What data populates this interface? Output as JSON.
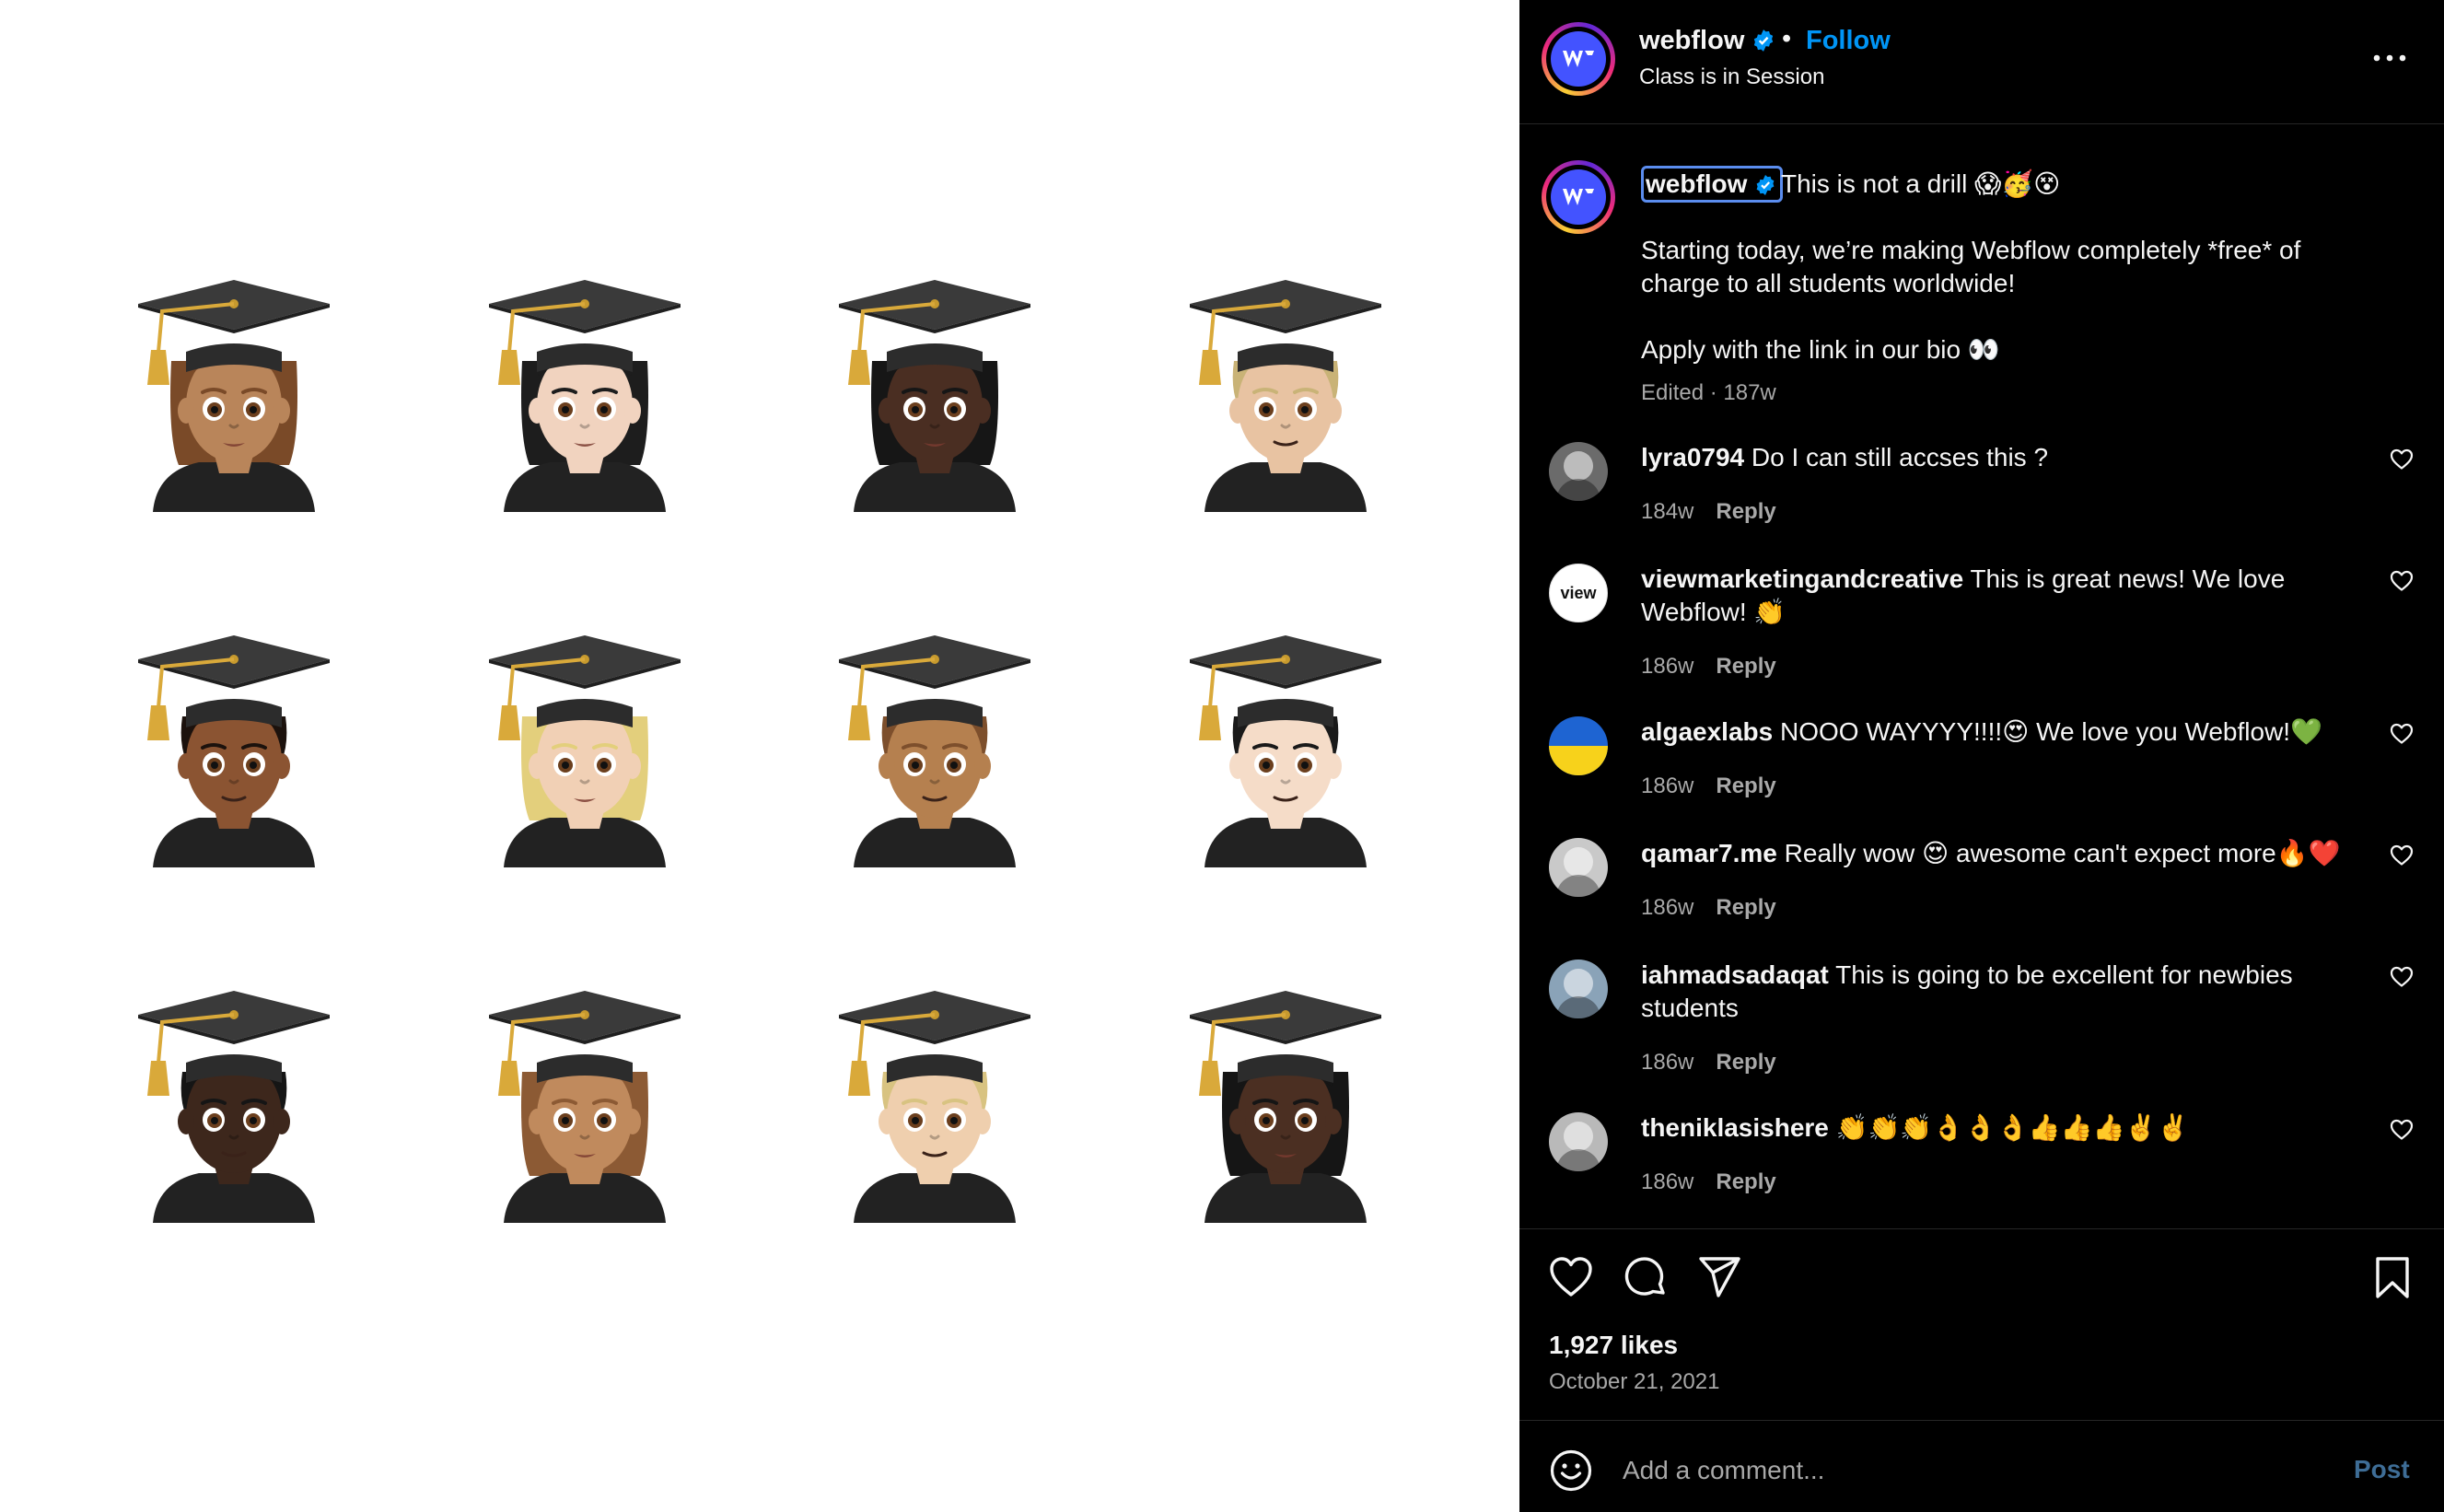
{
  "media": {
    "grads": [
      {
        "skin": "#b9855a",
        "hair": "#7a4a28",
        "style": "long",
        "feminine": true
      },
      {
        "skin": "#f1d3bf",
        "hair": "#1d1d1d",
        "style": "long",
        "feminine": true
      },
      {
        "skin": "#4a2e22",
        "hair": "#161616",
        "style": "long",
        "feminine": true
      },
      {
        "skin": "#e8c3a2",
        "hair": "#c9b377",
        "style": "short",
        "feminine": false
      },
      {
        "skin": "#8b5432",
        "hair": "#1c120d",
        "style": "short",
        "feminine": false
      },
      {
        "skin": "#f1d0b5",
        "hair": "#e3cf7c",
        "style": "long",
        "feminine": true
      },
      {
        "skin": "#b5804f",
        "hair": "#7d4f2c",
        "style": "short",
        "feminine": false
      },
      {
        "skin": "#f5dcc8",
        "hair": "#1a1a1a",
        "style": "short",
        "feminine": false
      },
      {
        "skin": "#3d271c",
        "hair": "#151515",
        "style": "short",
        "feminine": false
      },
      {
        "skin": "#c08a5d",
        "hair": "#8c5a34",
        "style": "long",
        "feminine": true
      },
      {
        "skin": "#efcfae",
        "hair": "#d8c381",
        "style": "short",
        "feminine": false
      },
      {
        "skin": "#4b2f22",
        "hair": "#151515",
        "style": "long",
        "feminine": true
      }
    ]
  },
  "header": {
    "username": "webflow",
    "dot": "•",
    "follow_label": "Follow",
    "subtitle": "Class is in Session",
    "more_icon": "more-horizontal-icon"
  },
  "caption": {
    "username": "webflow",
    "line1": "This is not a drill 😱🥳😵",
    "line2": "Starting today, we’re making Webflow completely *free* of",
    "line3": "charge to all students worldwide!",
    "line4": "Apply with the link in our bio 👀",
    "meta": "Edited · 187w"
  },
  "comments": [
    {
      "user": "lyra0794",
      "text1": "Do I can still accses this ?",
      "text2": "",
      "time": "184w",
      "reply": "Reply",
      "avatar_bg": "#6b6b6b"
    },
    {
      "user": "viewmarketingandcreative",
      "text1": "This is great news! We love",
      "text2": "Webflow! 👏",
      "time": "186w",
      "reply": "Reply",
      "avatar_bg": "#ffffff",
      "avatar_text": "view"
    },
    {
      "user": "algaexlabs",
      "text1": "NOOO WAYYYY!!!!😍 We love you Webflow!💚",
      "text2": "",
      "time": "186w",
      "reply": "Reply",
      "avatar_bg": "#1e64d2"
    },
    {
      "user": "qamar7.me",
      "text1": "Really wow 😍 awesome can't expect more🔥❤️",
      "text2": "",
      "time": "186w",
      "reply": "Reply",
      "avatar_bg": "#c9c9c9"
    },
    {
      "user": "iahmadsadaqat",
      "text1": "This is going to be excellent for newbies",
      "text2": "students",
      "time": "186w",
      "reply": "Reply",
      "avatar_bg": "#8aa3b8"
    },
    {
      "user": "theniklasishere",
      "text1": "👏👏👏👌👌👌👍👍👍✌️✌️",
      "text2": "",
      "time": "186w",
      "reply": "Reply",
      "avatar_bg": "#b9b9b9"
    }
  ],
  "actions": {
    "likes": "1,927 likes",
    "date": "October 21, 2021",
    "like_icon": "heart-icon",
    "comment_icon": "comment-icon",
    "share_icon": "share-icon",
    "save_icon": "bookmark-icon"
  },
  "composer": {
    "placeholder": "Add a comment...",
    "post_label": "Post",
    "emoji_icon": "smiley-icon"
  },
  "colors": {
    "follow": "#0095f6",
    "muted": "#a8a8a8",
    "post_disabled": "#3e6d96",
    "brand": "#4353ff"
  }
}
